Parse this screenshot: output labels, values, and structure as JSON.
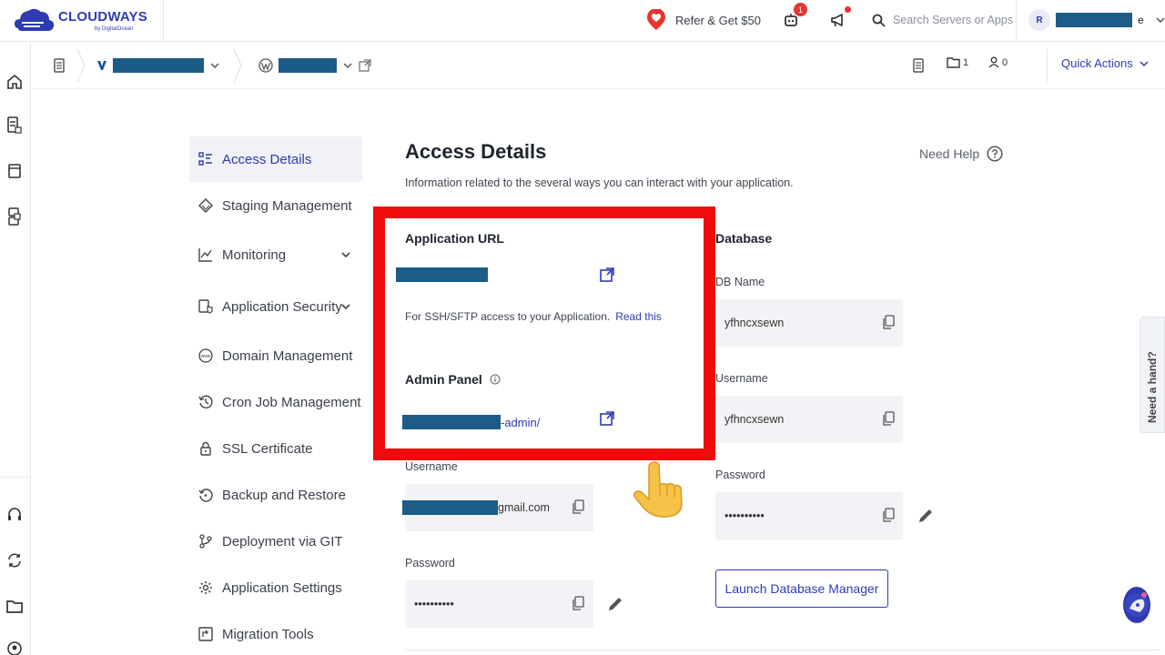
{
  "brand": {
    "name": "CLOUDWAYS",
    "sub": "by DigitalOcean"
  },
  "topbar": {
    "refer_label": "Refer & Get $50",
    "notification_count": "1",
    "search_placeholder": "Search Servers or Apps",
    "user_initial": "R",
    "user_name_suffix": "e"
  },
  "breadcrumb": {
    "folder_count": "1",
    "user_count": "0",
    "quick_actions": "Quick Actions"
  },
  "side_nav": [
    {
      "label": "Access Details",
      "icon": "list-icon",
      "active": true
    },
    {
      "label": "Staging Management",
      "icon": "layers-icon"
    },
    {
      "label": "Monitoring",
      "icon": "chart-icon",
      "has_chevron": true
    },
    {
      "label": "Application Security",
      "icon": "shield-doc-icon",
      "has_chevron": true
    },
    {
      "label": "Domain Management",
      "icon": "www-icon"
    },
    {
      "label": "Cron Job Management",
      "icon": "history-icon"
    },
    {
      "label": "SSL Certificate",
      "icon": "lock-icon"
    },
    {
      "label": "Backup and Restore",
      "icon": "restore-icon"
    },
    {
      "label": "Deployment via GIT",
      "icon": "git-icon"
    },
    {
      "label": "Application Settings",
      "icon": "gear-icon"
    },
    {
      "label": "Migration Tools",
      "icon": "migration-icon"
    }
  ],
  "main": {
    "title": "Access Details",
    "subtitle": "Information related to the several ways you can interact with your application.",
    "need_help": "Need Help",
    "application_url_label": "Application URL",
    "ssh_text": "For SSH/SFTP access to your Application.",
    "ssh_link": "Read this",
    "admin_panel_label": "Admin Panel",
    "admin_url_suffix": "-admin/",
    "admin_username_label": "Username",
    "admin_username_suffix": "gmail.com",
    "admin_password_label": "Password",
    "admin_password_value": "••••••••••"
  },
  "database": {
    "title": "Database",
    "db_name_label": "DB Name",
    "db_name_value": "yfhncxsewn",
    "username_label": "Username",
    "username_value": "yfhncxsewn",
    "password_label": "Password",
    "password_value": "••••••••••",
    "launch_button": "Launch Database Manager"
  },
  "widgets": {
    "need_hand": "Need a hand?"
  },
  "colors": {
    "accent": "#2f3bb0",
    "highlight_box": "#ee0c0c",
    "redaction": "#1c5c86"
  }
}
